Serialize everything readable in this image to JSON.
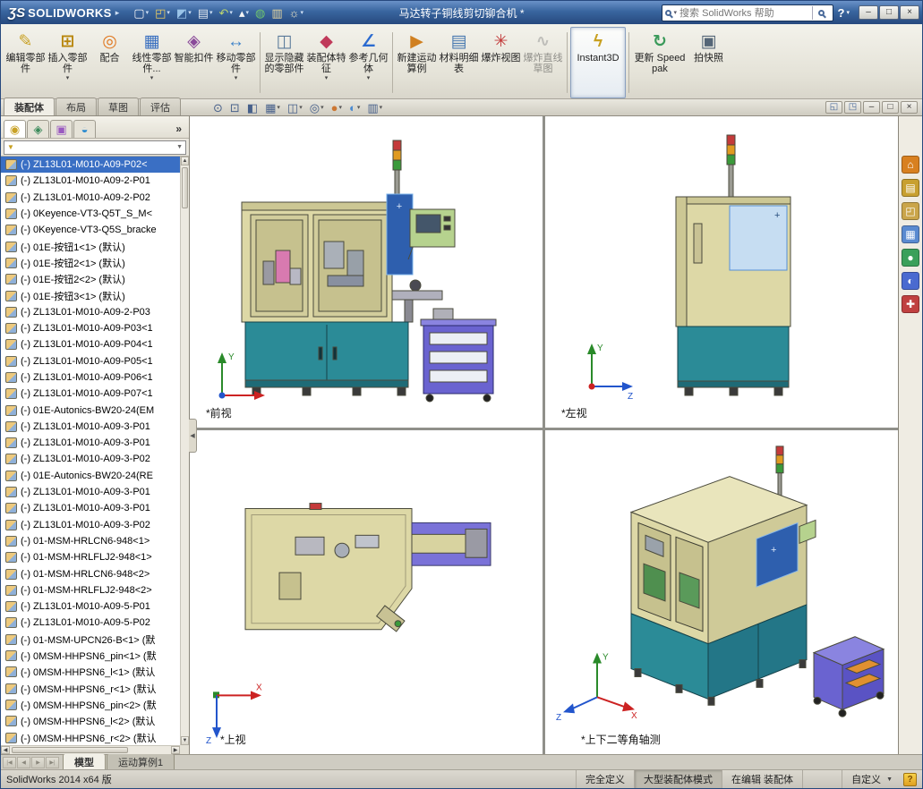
{
  "titlebar": {
    "logo_mark": "ƷS",
    "logo_text": "SOLIDWORKS",
    "document_title": "马达转子铜线剪切铆合机 *",
    "search_placeholder": "搜索 SolidWorks 帮助",
    "tools": [
      {
        "name": "new-document-button",
        "glyph": "▢",
        "color": "#f5f5f5",
        "dropdown": true
      },
      {
        "name": "open-document-button",
        "glyph": "◰",
        "color": "#f0d060",
        "dropdown": true
      },
      {
        "name": "save-button",
        "glyph": "◩",
        "color": "#9ac4e8",
        "dropdown": true
      },
      {
        "name": "print-button",
        "glyph": "▤",
        "color": "#dde4ee",
        "dropdown": true
      },
      {
        "name": "undo-button",
        "glyph": "↶",
        "color": "#bcd56f",
        "dropdown": true
      },
      {
        "name": "select-button",
        "glyph": "▴",
        "color": "#f5f5f5",
        "dropdown": true
      },
      {
        "name": "rebuild-button",
        "glyph": "◍",
        "color": "#6fc46f"
      },
      {
        "name": "file-properties-button",
        "glyph": "▥",
        "color": "#e8d8a0"
      },
      {
        "name": "options-button",
        "glyph": "☼",
        "color": "#f0e8c8",
        "dropdown": true
      }
    ]
  },
  "glyphs": {
    "logo_arrow": "▸",
    "help": "?",
    "win_min": "–",
    "win_max": "□",
    "win_close": "×",
    "chevron_more": "»",
    "filter_funnel": "▼",
    "filter_arrow": "▼",
    "scroll_up": "▲",
    "scroll_down": "▼",
    "scroll_left": "◀",
    "scroll_right": "▶",
    "panel_collapse": "◀"
  },
  "ribbon": {
    "items": [
      {
        "name": "edit-component-button",
        "label": "编辑零部件",
        "glyph": "✎",
        "color": "#c9a227"
      },
      {
        "name": "insert-component-button",
        "label": "插入零部件",
        "glyph": "⊞",
        "color": "#b8860b",
        "dropdown": true
      },
      {
        "name": "mate-button",
        "label": "配合",
        "glyph": "◎",
        "color": "#e07820"
      },
      {
        "name": "linear-component-pattern-button",
        "label": "线性零部件...",
        "glyph": "▦",
        "color": "#3a70c0",
        "dropdown": true
      },
      {
        "name": "smart-fasteners-button",
        "label": "智能扣件",
        "glyph": "◈",
        "color": "#8a4a9a"
      },
      {
        "name": "move-component-button",
        "label": "移动零部件",
        "glyph": "↔",
        "color": "#3a80c8",
        "dropdown": true
      },
      {
        "name": "ribbon-separator",
        "sep": true
      },
      {
        "name": "show-hidden-components-button",
        "label": "显示隐藏的零部件",
        "glyph": "◫",
        "color": "#5a7a9a"
      },
      {
        "name": "assembly-features-button",
        "label": "装配体特征",
        "glyph": "◆",
        "color": "#c03a5a",
        "dropdown": true
      },
      {
        "name": "reference-geometry-button",
        "label": "参考几何体",
        "glyph": "∠",
        "color": "#2a6ad0",
        "dropdown": true
      },
      {
        "name": "ribbon-separator",
        "sep": true
      },
      {
        "name": "new-motion-study-button",
        "label": "新建运动算例",
        "glyph": "▶",
        "color": "#d08020"
      },
      {
        "name": "bill-of-materials-button",
        "label": "材料明细表",
        "glyph": "▤",
        "color": "#4a7ab0"
      },
      {
        "name": "exploded-view-button",
        "label": "爆炸视图",
        "glyph": "✳",
        "color": "#c23a3a"
      },
      {
        "name": "explode-line-sketch-button",
        "label": "爆炸直线草图",
        "glyph": "∿",
        "color": "#888888",
        "disabled": true
      },
      {
        "name": "ribbon-separator",
        "sep": true
      },
      {
        "name": "instant3d-button",
        "label": "Instant3D",
        "glyph": "ϟ",
        "color": "#c8a020",
        "active": true,
        "wide": true
      },
      {
        "name": "ribbon-separator",
        "sep": true
      },
      {
        "name": "update-speedpak-button",
        "label": "更新 Speedpak",
        "glyph": "↻",
        "color": "#3a9a5a",
        "wide": true
      },
      {
        "name": "take-snapshot-button",
        "label": "拍快照",
        "glyph": "▣",
        "color": "#556677"
      }
    ]
  },
  "command_tabs": [
    {
      "name": "tab-assembly",
      "label": "装配体",
      "active": true
    },
    {
      "name": "tab-layout",
      "label": "布局"
    },
    {
      "name": "tab-sketch",
      "label": "草图"
    },
    {
      "name": "tab-evaluate",
      "label": "评估"
    }
  ],
  "hud_tools": [
    {
      "name": "zoom-fit-icon",
      "glyph": "⊙",
      "color": "#47608a"
    },
    {
      "name": "zoom-area-icon",
      "glyph": "⊡",
      "color": "#47608a"
    },
    {
      "name": "section-view-icon",
      "glyph": "◧",
      "color": "#47608a"
    },
    {
      "name": "view-orientation-icon",
      "glyph": "▦",
      "color": "#47608a",
      "dropdown": true
    },
    {
      "name": "display-style-icon",
      "glyph": "◫",
      "color": "#47608a",
      "dropdown": true
    },
    {
      "name": "hide-show-items-icon",
      "glyph": "◎",
      "color": "#47608a",
      "dropdown": true
    },
    {
      "name": "edit-appearance-icon",
      "glyph": "●",
      "color": "#cc7733",
      "dropdown": true
    },
    {
      "name": "apply-scene-icon",
      "glyph": "◐",
      "color": "#4a8ad0",
      "dropdown": true
    },
    {
      "name": "view-settings-icon",
      "glyph": "▥",
      "color": "#47608a",
      "dropdown": true
    }
  ],
  "window_controls": [
    {
      "name": "tile-viewports-button",
      "glyph": "◱",
      "color": "#4a6a9a"
    },
    {
      "name": "single-viewport-button",
      "glyph": "◳",
      "color": "#4a6a9a"
    },
    {
      "name": "minimize-document-button",
      "glyph": "–",
      "color": "#333333"
    },
    {
      "name": "restore-document-button",
      "glyph": "□",
      "color": "#333333"
    },
    {
      "name": "close-document-button",
      "glyph": "×",
      "color": "#333333"
    }
  ],
  "panel_tabs": [
    {
      "name": "featuremanager-tab",
      "glyph": "◉",
      "color": "#c9a227",
      "active": true
    },
    {
      "name": "propertymanager-tab",
      "glyph": "◈",
      "color": "#3a8a5a"
    },
    {
      "name": "configurationmanager-tab",
      "glyph": "▣",
      "color": "#9a5ac0"
    },
    {
      "name": "displaymanager-tab",
      "glyph": "◒",
      "color": "#2a8ad0"
    }
  ],
  "tree": {
    "items": [
      {
        "name": "tree-item",
        "label": "(-) ZL13L01-M010-A09-P02<",
        "selected": true
      },
      {
        "name": "tree-item",
        "label": "(-) ZL13L01-M010-A09-2-P01"
      },
      {
        "name": "tree-item",
        "label": "(-) ZL13L01-M010-A09-2-P02"
      },
      {
        "name": "tree-item",
        "label": "(-) 0Keyence-VT3-Q5T_S_M<"
      },
      {
        "name": "tree-item",
        "label": "(-) 0Keyence-VT3-Q5S_bracke"
      },
      {
        "name": "tree-item",
        "label": "(-) 01E-按钮1<1> (默认)"
      },
      {
        "name": "tree-item",
        "label": "(-) 01E-按钮2<1> (默认)"
      },
      {
        "name": "tree-item",
        "label": "(-) 01E-按钮2<2> (默认)"
      },
      {
        "name": "tree-item",
        "label": "(-) 01E-按钮3<1> (默认)"
      },
      {
        "name": "tree-item",
        "label": "(-) ZL13L01-M010-A09-2-P03"
      },
      {
        "name": "tree-item",
        "label": "(-) ZL13L01-M010-A09-P03<1"
      },
      {
        "name": "tree-item",
        "label": "(-) ZL13L01-M010-A09-P04<1"
      },
      {
        "name": "tree-item",
        "label": "(-) ZL13L01-M010-A09-P05<1"
      },
      {
        "name": "tree-item",
        "label": "(-) ZL13L01-M010-A09-P06<1"
      },
      {
        "name": "tree-item",
        "label": "(-) ZL13L01-M010-A09-P07<1"
      },
      {
        "name": "tree-item",
        "label": "(-) 01E-Autonics-BW20-24(EM"
      },
      {
        "name": "tree-item",
        "label": "(-) ZL13L01-M010-A09-3-P01"
      },
      {
        "name": "tree-item",
        "label": "(-) ZL13L01-M010-A09-3-P01"
      },
      {
        "name": "tree-item",
        "label": "(-) ZL13L01-M010-A09-3-P02"
      },
      {
        "name": "tree-item",
        "label": "(-) 01E-Autonics-BW20-24(RE"
      },
      {
        "name": "tree-item",
        "label": "(-) ZL13L01-M010-A09-3-P01"
      },
      {
        "name": "tree-item",
        "label": "(-) ZL13L01-M010-A09-3-P01"
      },
      {
        "name": "tree-item",
        "label": "(-) ZL13L01-M010-A09-3-P02"
      },
      {
        "name": "tree-item",
        "label": "(-) 01-MSM-HRLCN6-948<1>"
      },
      {
        "name": "tree-item",
        "label": "(-) 01-MSM-HRLFLJ2-948<1>"
      },
      {
        "name": "tree-item",
        "label": "(-) 01-MSM-HRLCN6-948<2>"
      },
      {
        "name": "tree-item",
        "label": "(-) 01-MSM-HRLFLJ2-948<2>"
      },
      {
        "name": "tree-item",
        "label": "(-) ZL13L01-M010-A09-5-P01"
      },
      {
        "name": "tree-item",
        "label": "(-) ZL13L01-M010-A09-5-P02"
      },
      {
        "name": "tree-item",
        "label": "(-) 01-MSM-UPCN26-B<1> (默"
      },
      {
        "name": "tree-item",
        "label": "(-) 0MSM-HHPSN6_pin<1> (默"
      },
      {
        "name": "tree-item",
        "label": "(-) 0MSM-HHPSN6_l<1> (默认"
      },
      {
        "name": "tree-item",
        "label": "(-) 0MSM-HHPSN6_r<1> (默认"
      },
      {
        "name": "tree-item",
        "label": "(-) 0MSM-HHPSN6_pin<2> (默"
      },
      {
        "name": "tree-item",
        "label": "(-) 0MSM-HHPSN6_l<2> (默认"
      },
      {
        "name": "tree-item",
        "label": "(-) 0MSM-HHPSN6_r<2> (默认"
      }
    ]
  },
  "viewports": [
    {
      "label": "*前视"
    },
    {
      "label": "*左视"
    },
    {
      "label": "*上视"
    },
    {
      "label": "*上下二等角轴测"
    }
  ],
  "taskpane_icons": [
    {
      "name": "taskpane-resources-icon",
      "glyph": "⌂",
      "color": "#d88020"
    },
    {
      "name": "taskpane-design-library-icon",
      "glyph": "▤",
      "color": "#c8a030"
    },
    {
      "name": "taskpane-file-explorer-icon",
      "glyph": "◰",
      "color": "#caa54a"
    },
    {
      "name": "taskpane-view-palette-icon",
      "glyph": "▦",
      "color": "#5a8ad0"
    },
    {
      "name": "taskpane-appearances-icon",
      "glyph": "●",
      "color": "#3aa05a"
    },
    {
      "name": "taskpane-scenes-icon",
      "glyph": "◐",
      "color": "#4a6ad0"
    },
    {
      "name": "taskpane-custom-properties-icon",
      "glyph": "✚",
      "color": "#c04040"
    }
  ],
  "bottom_nav": [
    {
      "name": "first-tab-button",
      "glyph": "|◀"
    },
    {
      "name": "prev-tab-button",
      "glyph": "◀"
    },
    {
      "name": "next-tab-button",
      "glyph": "▶"
    },
    {
      "name": "last-tab-button",
      "glyph": "▶|"
    }
  ],
  "bottom_tabs": [
    {
      "name": "model-tab",
      "label": "模型",
      "active": true
    },
    {
      "name": "motion-study-tab",
      "label": "运动算例1"
    }
  ],
  "statusbar": {
    "left": "SolidWorks 2014 x64 版",
    "segments": [
      {
        "name": "status-fully-defined",
        "label": "完全定义"
      },
      {
        "name": "status-large-assembly-mode",
        "label": "大型装配体模式",
        "pressed": true
      },
      {
        "name": "status-editing-assembly",
        "label": "在编辑 装配体"
      },
      {
        "name": "status-spacer",
        "label": "",
        "spacer": true
      },
      {
        "name": "status-custom-dropdown",
        "label": "自定义",
        "dropdown": true
      }
    ],
    "quick_tips_glyph": "?"
  }
}
